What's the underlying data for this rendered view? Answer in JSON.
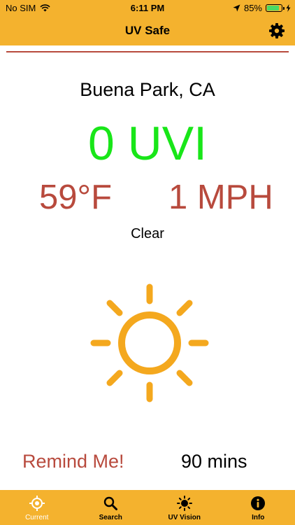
{
  "status_bar": {
    "carrier": "No SIM",
    "time": "6:11 PM",
    "battery": "85%",
    "battery_level": 0.85
  },
  "nav": {
    "title": "UV Safe"
  },
  "weather": {
    "location": "Buena Park, CA",
    "uvi": "0 UVI",
    "temperature": "59°F",
    "wind": "1 MPH",
    "condition": "Clear"
  },
  "reminder": {
    "button_label": "Remind Me!",
    "duration": "90 mins"
  },
  "tabs": [
    {
      "label": "Current",
      "icon": "location-target-icon",
      "active": true
    },
    {
      "label": "Search",
      "icon": "magnifier-icon",
      "active": false
    },
    {
      "label": "UV Vision",
      "icon": "sun-icon",
      "active": false
    },
    {
      "label": "Info",
      "icon": "info-icon",
      "active": false
    }
  ],
  "colors": {
    "bar": "#F4B22E",
    "accent_red": "#B84A3D",
    "uvi_green": "#19E619",
    "sun": "#F4A81E"
  }
}
